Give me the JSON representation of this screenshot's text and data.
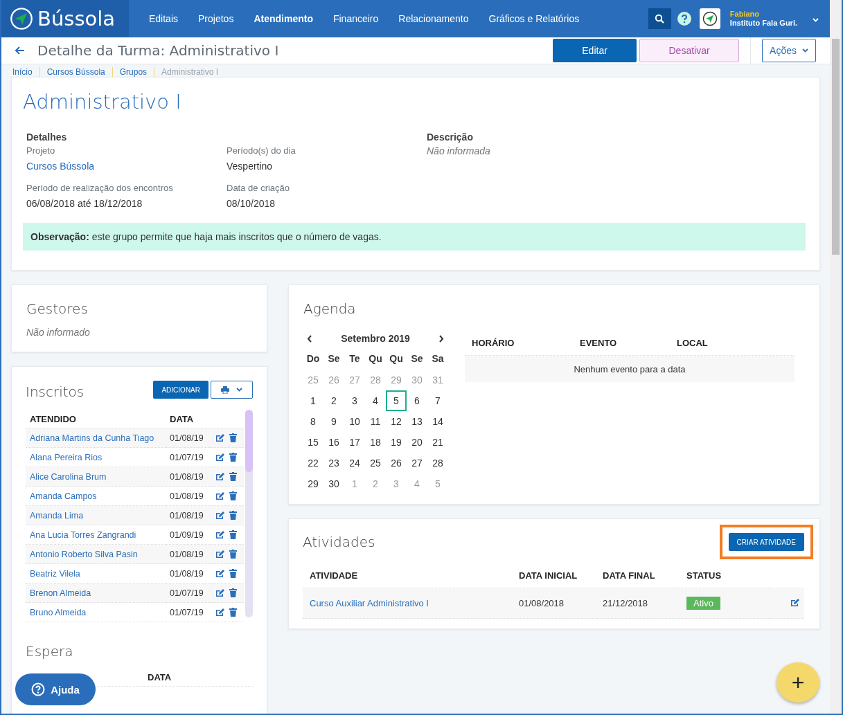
{
  "topbar": {
    "logo": "Bússola",
    "nav": [
      {
        "label": "Editais",
        "selected": false
      },
      {
        "label": "Projetos",
        "selected": false
      },
      {
        "label": "Atendimento",
        "selected": true
      },
      {
        "label": "Financeiro",
        "selected": false
      },
      {
        "label": "Relacionamento",
        "selected": false
      },
      {
        "label": "Gráficos e Relatórios",
        "selected": false
      }
    ],
    "user": {
      "name": "Fabiano",
      "org": "Instituto Fala Guri."
    }
  },
  "header": {
    "title": "Detalhe da Turma: Administrativo I",
    "buttons": [
      {
        "label": "Editar",
        "kind": "primary"
      },
      {
        "label": "Desativar",
        "kind": "soft"
      }
    ],
    "actions": "Ações"
  },
  "breadcrumb": [
    "Início",
    "Cursos Bússola",
    "Grupos",
    "Administrativo I"
  ],
  "group": {
    "title": "Administrativo I",
    "details_heading": "Detalhes",
    "fields": [
      {
        "label": "Projeto",
        "value": "Cursos Bússola",
        "kind": "link"
      },
      {
        "label": "Período(s) do dia",
        "value": "Vespertino",
        "kind": "text"
      },
      {
        "label": "Período de realização dos encontros",
        "value": "06/08/2018 até 18/12/2018",
        "kind": "text"
      },
      {
        "label": "Data de criação",
        "value": "08/10/2018",
        "kind": "text"
      }
    ],
    "description_heading": "Descrição",
    "description": "Não informada",
    "note": "**Observação:** este grupo permite que haja mais inscritos que o número de vagas."
  },
  "managers": {
    "title": "Gestores",
    "empty": "Não informado"
  },
  "enrolled": {
    "title": "Inscritos",
    "add": "ADICIONAR",
    "columns": [
      "ATENDIDO",
      "DATA"
    ],
    "rows": [
      {
        "name": "Adriana Martins da Cunha Tiago",
        "date": "01/08/19"
      },
      {
        "name": "Alana Pereira Rios",
        "date": "01/07/19"
      },
      {
        "name": "Alice Carolina Brum",
        "date": "01/08/19"
      },
      {
        "name": "Amanda Campos",
        "date": "01/08/19"
      },
      {
        "name": "Amanda Lima",
        "date": "01/08/19"
      },
      {
        "name": "Ana Lucia Torres Zangrandi",
        "date": "01/09/19"
      },
      {
        "name": "Antonio Roberto Silva Pasin",
        "date": "01/08/19"
      },
      {
        "name": "Beatriz Vilela",
        "date": "01/08/19"
      },
      {
        "name": "Brenon Almeida",
        "date": "01/07/19"
      },
      {
        "name": "Bruno Almeida",
        "date": "01/07/19"
      }
    ]
  },
  "waiting": {
    "title": "Espera",
    "columns": [
      "DATA"
    ]
  },
  "agenda": {
    "title": "Agenda",
    "month": "Setembro 2019",
    "weekdays": [
      "Do",
      "Se",
      "Te",
      "Qu",
      "Qu",
      "Se",
      "Sa"
    ],
    "weeks": [
      [
        {
          "d": "25",
          "muted": true,
          "selected": false
        },
        {
          "d": "26",
          "muted": true,
          "selected": false
        },
        {
          "d": "27",
          "muted": true,
          "selected": false
        },
        {
          "d": "28",
          "muted": true,
          "selected": false
        },
        {
          "d": "29",
          "muted": true,
          "selected": false
        },
        {
          "d": "30",
          "muted": true,
          "selected": false
        },
        {
          "d": "31",
          "muted": true,
          "selected": false
        }
      ],
      [
        {
          "d": "1",
          "muted": false,
          "selected": false
        },
        {
          "d": "2",
          "muted": false,
          "selected": false
        },
        {
          "d": "3",
          "muted": false,
          "selected": false
        },
        {
          "d": "4",
          "muted": false,
          "selected": false
        },
        {
          "d": "5",
          "muted": false,
          "selected": true
        },
        {
          "d": "6",
          "muted": false,
          "selected": false
        },
        {
          "d": "7",
          "muted": false,
          "selected": false
        }
      ],
      [
        {
          "d": "8",
          "muted": false,
          "selected": false
        },
        {
          "d": "9",
          "muted": false,
          "selected": false
        },
        {
          "d": "10",
          "muted": false,
          "selected": false
        },
        {
          "d": "11",
          "muted": false,
          "selected": false
        },
        {
          "d": "12",
          "muted": false,
          "selected": false
        },
        {
          "d": "13",
          "muted": false,
          "selected": false
        },
        {
          "d": "14",
          "muted": false,
          "selected": false
        }
      ],
      [
        {
          "d": "15",
          "muted": false,
          "selected": false
        },
        {
          "d": "16",
          "muted": false,
          "selected": false
        },
        {
          "d": "17",
          "muted": false,
          "selected": false
        },
        {
          "d": "18",
          "muted": false,
          "selected": false
        },
        {
          "d": "19",
          "muted": false,
          "selected": false
        },
        {
          "d": "20",
          "muted": false,
          "selected": false
        },
        {
          "d": "21",
          "muted": false,
          "selected": false
        }
      ],
      [
        {
          "d": "22",
          "muted": false,
          "selected": false
        },
        {
          "d": "23",
          "muted": false,
          "selected": false
        },
        {
          "d": "24",
          "muted": false,
          "selected": false
        },
        {
          "d": "25",
          "muted": false,
          "selected": false
        },
        {
          "d": "26",
          "muted": false,
          "selected": false
        },
        {
          "d": "27",
          "muted": false,
          "selected": false
        },
        {
          "d": "28",
          "muted": false,
          "selected": false
        }
      ],
      [
        {
          "d": "29",
          "muted": false,
          "selected": false
        },
        {
          "d": "30",
          "muted": false,
          "selected": false
        },
        {
          "d": "1",
          "muted": true,
          "selected": false
        },
        {
          "d": "2",
          "muted": true,
          "selected": false
        },
        {
          "d": "3",
          "muted": true,
          "selected": false
        },
        {
          "d": "4",
          "muted": true,
          "selected": false
        },
        {
          "d": "5",
          "muted": true,
          "selected": false
        }
      ]
    ],
    "columns": [
      "HORÁRIO",
      "EVENTO",
      "LOCAL"
    ],
    "empty": "Nenhum evento para a data"
  },
  "activities": {
    "title": "Atividades",
    "create": "CRIAR ATIVIDADE",
    "columns": [
      "ATIVIDADE",
      "DATA INICIAL",
      "DATA FINAL",
      "STATUS"
    ],
    "rows": [
      {
        "name": "Curso Auxiliar Administrativo I",
        "start": "01/08/2018",
        "end": "21/12/2018",
        "status": "Ativo",
        "color": "#5cb85c"
      }
    ]
  },
  "help": "Ajuda",
  "fab": "+"
}
